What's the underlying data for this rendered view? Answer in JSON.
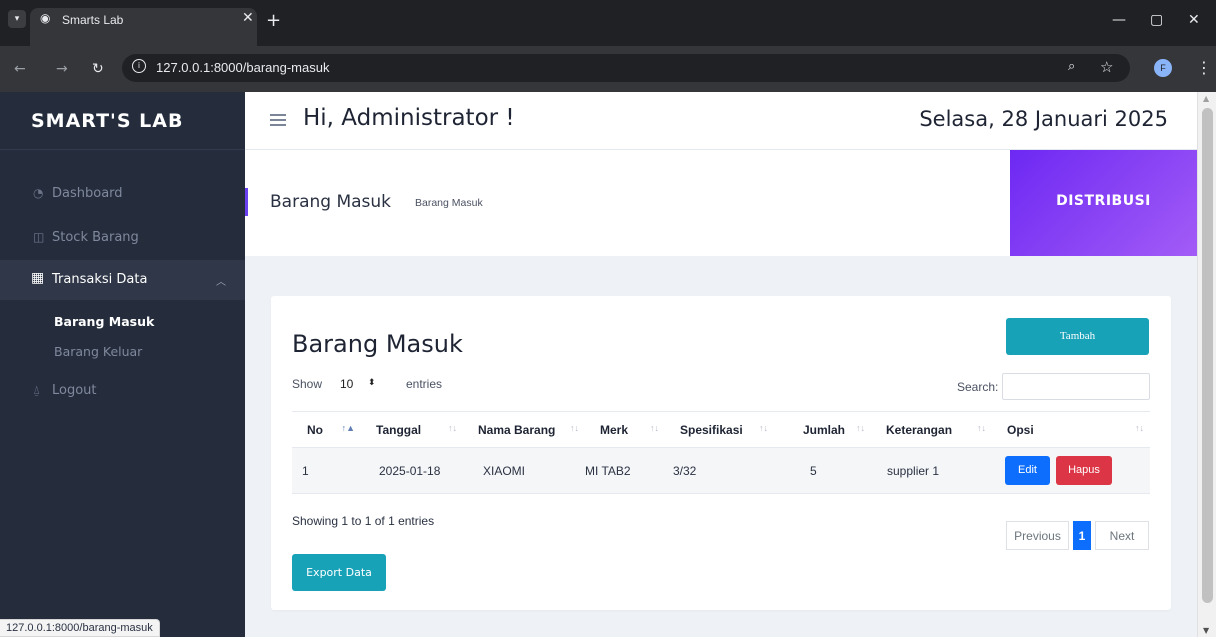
{
  "browser": {
    "tab_title": "Smarts Lab",
    "url": "127.0.0.1:8000/barang-masuk",
    "profile_initial": "F",
    "status_url": "127.0.0.1:8000/barang-masuk"
  },
  "sidebar": {
    "brand": "SMART'S LAB",
    "items": [
      {
        "label": "Dashboard",
        "icon": "dashboard-icon"
      },
      {
        "label": "Stock Barang",
        "icon": "box-icon"
      },
      {
        "label": "Transaksi Data",
        "icon": "table-icon",
        "expanded": true
      },
      {
        "label": "Logout",
        "icon": "logout-icon"
      }
    ],
    "sub_items": [
      {
        "label": "Barang Masuk",
        "current": true
      },
      {
        "label": "Barang Keluar",
        "current": false
      }
    ]
  },
  "topbar": {
    "greeting": "Hi, Administrator !",
    "date": "Selasa, 28 Januari 2025"
  },
  "page_header": {
    "title": "Barang Masuk",
    "breadcrumb": "Barang Masuk",
    "badge": "DISTRIBUSI"
  },
  "card": {
    "title": "Barang Masuk",
    "add_button": "Tambah",
    "length": {
      "show": "Show",
      "value": "10",
      "entries": "entries"
    },
    "search_label": "Search:",
    "search_value": "",
    "columns": [
      "No",
      "Tanggal",
      "Nama Barang",
      "Merk",
      "Spesifikasi",
      "Jumlah",
      "Keterangan",
      "Opsi"
    ],
    "rows": [
      {
        "no": "1",
        "tanggal": "2025-01-18",
        "nama_barang": "XIAOMI",
        "merk": "MI TAB2",
        "spesifikasi": "3/32",
        "jumlah": "5",
        "keterangan": "supplier 1",
        "edit": "Edit",
        "hapus": "Hapus"
      }
    ],
    "info": "Showing 1 to 1 of 1 entries",
    "pagination": {
      "previous": "Previous",
      "current": "1",
      "next": "Next"
    },
    "export_button": "Export Data"
  },
  "colors": {
    "sidebar_bg": "#252d3d",
    "accent_purple": "#6d28f3",
    "teal": "#17a2b8",
    "primary_blue": "#0d6efd",
    "danger_red": "#dc3545"
  }
}
